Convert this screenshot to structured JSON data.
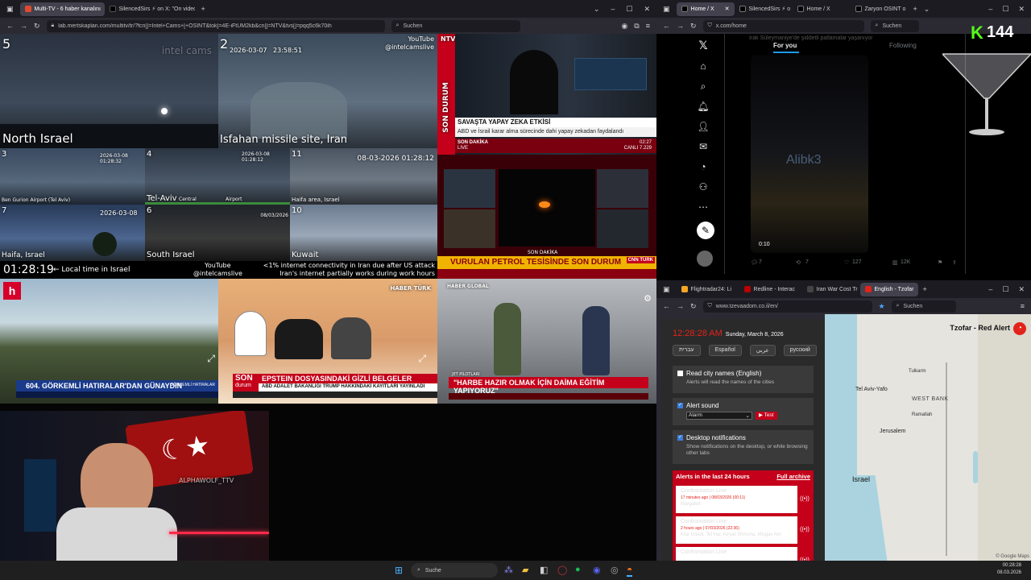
{
  "left_browser": {
    "tabs": [
      {
        "label": "Multi-TV - 6 haber kanalını",
        "active": true,
        "color": "#e04a2f"
      },
      {
        "label": "SilencedSirs ⚡ on X: \"On video",
        "active": false,
        "color": "#000000"
      }
    ],
    "url": "lab.mertskaplan.com/multitv/tr/?fcn[]=Intel+Cams+[+OSINT&tok]=4E-iFtUM2kb&cn[]=NTV&tvs[]=pqq5c6k70ih",
    "search_placeholder": "Suchen"
  },
  "feeds": {
    "cam5": {
      "num": "5",
      "label": "North Israel",
      "watermark": "intel cams"
    },
    "cam2": {
      "num": "2",
      "date": "2026-03-07",
      "time": "23:58:51",
      "label": "Isfahan missile site, Iran",
      "yt_label": "YouTube",
      "yt_handle": "@intelcamslive"
    },
    "cam3": {
      "num": "3",
      "date": "2026-03-08 01:28:32",
      "label": "Ben Gurion Airport (Tel Aviv)"
    },
    "cam4": {
      "num": "4",
      "date": "2026-03-08 01:28:12",
      "label": "Tel-Aviv",
      "sub1": "Central",
      "sub2": "Airport"
    },
    "cam11": {
      "num": "11",
      "date": "08-03-2026 01:28:12",
      "label": "Haifa area, Israel"
    },
    "cam7": {
      "num": "7",
      "date": "2026-03-08",
      "label": "Haifa, Israel"
    },
    "cam6": {
      "num": "6",
      "date": "08/03/2026",
      "label": "South Israel"
    },
    "cam10": {
      "num": "10",
      "label": "Kuwait"
    },
    "footer": {
      "clock": "01:28:19",
      "local_note": "← Local time in Israel",
      "yt_label": "YouTube",
      "yt_handle": "@intelcamslive",
      "ticker1": "<1% internet connectivity in Iran due after US attack",
      "ticker2": "Iran's internet partially works during work hours"
    },
    "ntv": {
      "logo": "NTV",
      "side": "SON DURUM",
      "headline": "SAVAŞTA YAPAY ZEKA ETKİSİ",
      "sub": "ABD ve İsrail karar alma sürecinde dahi yapay zekadan faydalandı",
      "son": "SON DAKİKA",
      "live": "LIVE",
      "time": "02:27",
      "bist": "CANLI 7.229"
    },
    "cnn": {
      "title": "VURULAN PETROL TESİSİNDE SON DURUM",
      "son": "SON DAKİKA",
      "logo": "CNN TÜRK"
    },
    "halk": {
      "headline": "604. GÖRKEMLİ HATIRALAR'DAN GÜNAYDIN",
      "tag": "GÖRKEMLİ HATIRALAR"
    },
    "haberturk": {
      "logo": "HABER TÜRK",
      "son": "SON",
      "durum": "durum",
      "headline": "EPSTEIN DOSYASINDAKİ GİZLİ BELGELER",
      "sub": "ABD ADALET BAKANLIĞI TRUMP HAKKINDAKİ KAYITLARI YAYINLADI"
    },
    "haberglobal": {
      "logo": "HABER GLOBAL",
      "tag": "JET PİLOTLARI",
      "headline": "\"HARBE HAZIR OLMAK İÇİN DAİMA EĞİTİM YAPIYORUZ\""
    }
  },
  "webcam": {
    "nickname": "ALPHAWOLF_TTV"
  },
  "right_browser": {
    "tabs": [
      {
        "label": "Home / X",
        "active": true
      },
      {
        "label": "SilencedSirs ⚡ o",
        "active": false
      },
      {
        "label": "Home / X",
        "active": false
      },
      {
        "label": "Zaryon OSINT o",
        "active": false
      }
    ],
    "url": "x.com/home",
    "search_placeholder": "Suchen"
  },
  "x": {
    "tab_foryou": "For you",
    "tab_following": "Following",
    "top_text": "Irak Süleymaniye'de şiddetli patlamalar yaşanıyor",
    "watermark": "Alibk3",
    "duration": "0:10",
    "stats": {
      "replies": "7",
      "reposts": "7",
      "likes": "127",
      "views": "12K"
    },
    "kick_logo": "K",
    "kick_count": "144"
  },
  "tzofar_browser": {
    "tabs": [
      {
        "label": "Flightradar24: Li",
        "active": false
      },
      {
        "label": "Redline - Interac",
        "active": false
      },
      {
        "label": "Iran War Cost Tr",
        "active": false
      },
      {
        "label": "English - Tzofar",
        "active": true
      }
    ],
    "url": "www.tzevaadom.co.il/en/",
    "search_placeholder": "Suchen"
  },
  "tzofar": {
    "time": "12:28:28 AM",
    "date": "Sunday, March 8, 2026",
    "languages": [
      "עברית",
      "Español",
      "عربي",
      "русский"
    ],
    "read_city": {
      "title": "Read city names (English)",
      "desc": "Alerts will read the names of the cities"
    },
    "alert_sound": {
      "title": "Alert sound",
      "option": "Alarm",
      "test": "▶ Test"
    },
    "desktop": {
      "title": "Desktop notifications",
      "desc": "Show notifications on the desktop, or while browsing other tabs"
    },
    "alerts_header": "Alerts in the last 24 hours",
    "full_archive": "Full archive",
    "alerts": [
      {
        "title": "Confrontation Line",
        "when": "17 minutes ago | 08/03/2026 (00:11)",
        "places": "Margaliot"
      },
      {
        "title": "Confrontation Line",
        "when": "2 hours ago | 07/03/2026 (22:36)",
        "places": "Kfar Giladi, Tel Hai, Kiryat Shmona, Misgav Am"
      },
      {
        "title": "Confrontation Line",
        "when": "",
        "places": ""
      }
    ],
    "map_title": "Tzofar - Red Alert",
    "map_labels": [
      "Tel Aviv-Yafo",
      "WEST BANK",
      "Jerusalem",
      "Israel",
      "Tulkarm",
      "Ramallah"
    ],
    "map_credit": "© Google Maps"
  },
  "taskbar": {
    "search_placeholder": "Suche",
    "time": "00:28:28",
    "date": "08.03.2026"
  },
  "colors": {
    "red": "#c4001a",
    "x_bg": "#000000",
    "tzofar_red": "#e2231a"
  }
}
